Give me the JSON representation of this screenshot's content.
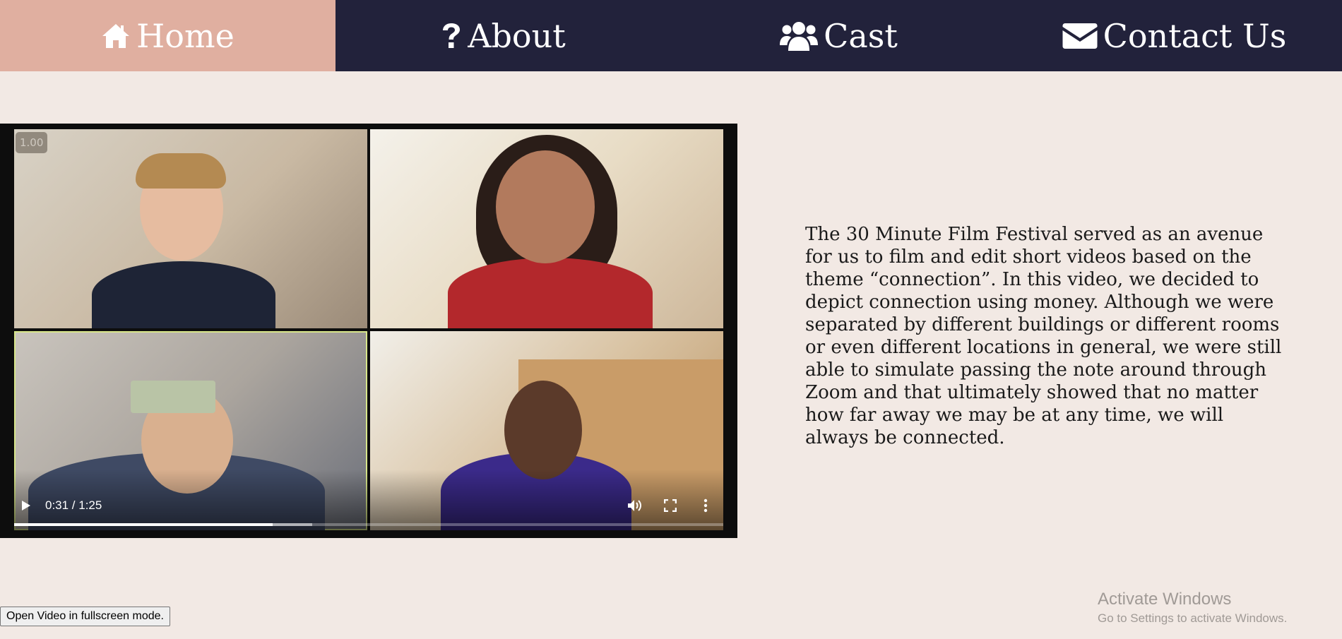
{
  "nav": {
    "items": [
      {
        "label": "Home",
        "icon": "home-icon",
        "active": true
      },
      {
        "label": "About",
        "icon": "question-icon",
        "active": false
      },
      {
        "label": "Cast",
        "icon": "users-icon",
        "active": false
      },
      {
        "label": "Contact Us",
        "icon": "envelope-icon",
        "active": false
      }
    ],
    "colors": {
      "background": "#22223b",
      "active": "#e0afa0",
      "text": "#ffffff"
    }
  },
  "video": {
    "badge": "1.00",
    "time": "0:31 / 1:25",
    "progress_played": 0.3647,
    "progress_buffered": 0.42
  },
  "description": "The 30 Minute Film Festival served as an avenue for us to film and edit short videos based on the theme “connection”. In this video, we decided to depict connection using money. Although we were separated by different buildings or different rooms or even different locations in general, we were still able to simulate passing the note around through Zoom and that ultimately showed that no matter how far away we may be at any time, we will always be connected.",
  "fullscreen_button": "Open Video in fullscreen mode.",
  "watermark": {
    "title": "Activate Windows",
    "subtitle": "Go to Settings to activate Windows."
  },
  "page_background": "#f2e9e4"
}
